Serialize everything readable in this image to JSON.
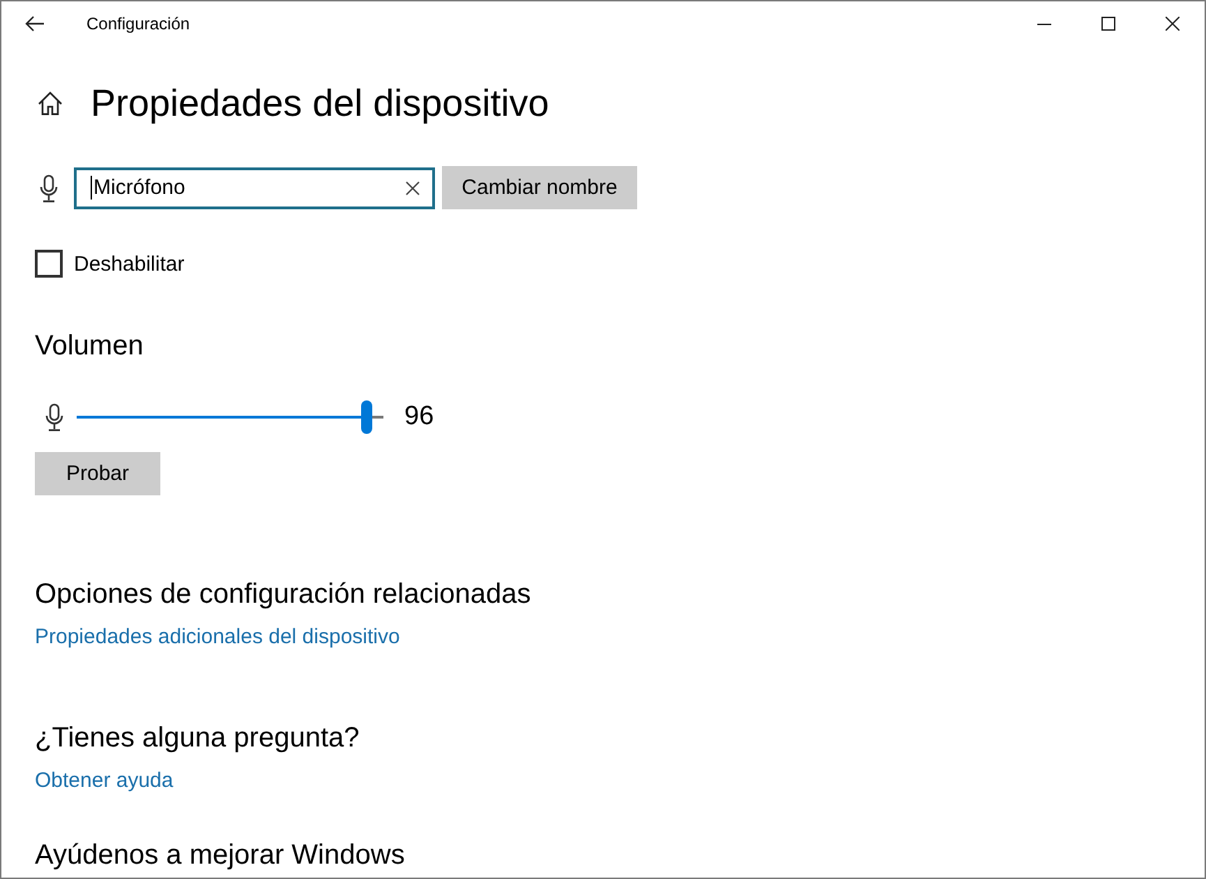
{
  "window": {
    "title": "Configuración"
  },
  "page": {
    "title": "Propiedades del dispositivo"
  },
  "name_field": {
    "value": "Micrófono",
    "focused": true
  },
  "rename_button": "Cambiar nombre",
  "disable": {
    "label": "Deshabilitar",
    "checked": false
  },
  "volume": {
    "title": "Volumen",
    "level": 0.96,
    "reading": "96",
    "test_button": "Probar"
  },
  "sections": [
    {
      "title": "Opciones de configuración relacionadas",
      "link": "Propiedades adicionales del dispositivo"
    },
    {
      "title": "¿Tienes alguna pregunta?",
      "link": "Obtener ayuda"
    },
    {
      "title": "Ayúdenos a mejorar Windows"
    }
  ]
}
